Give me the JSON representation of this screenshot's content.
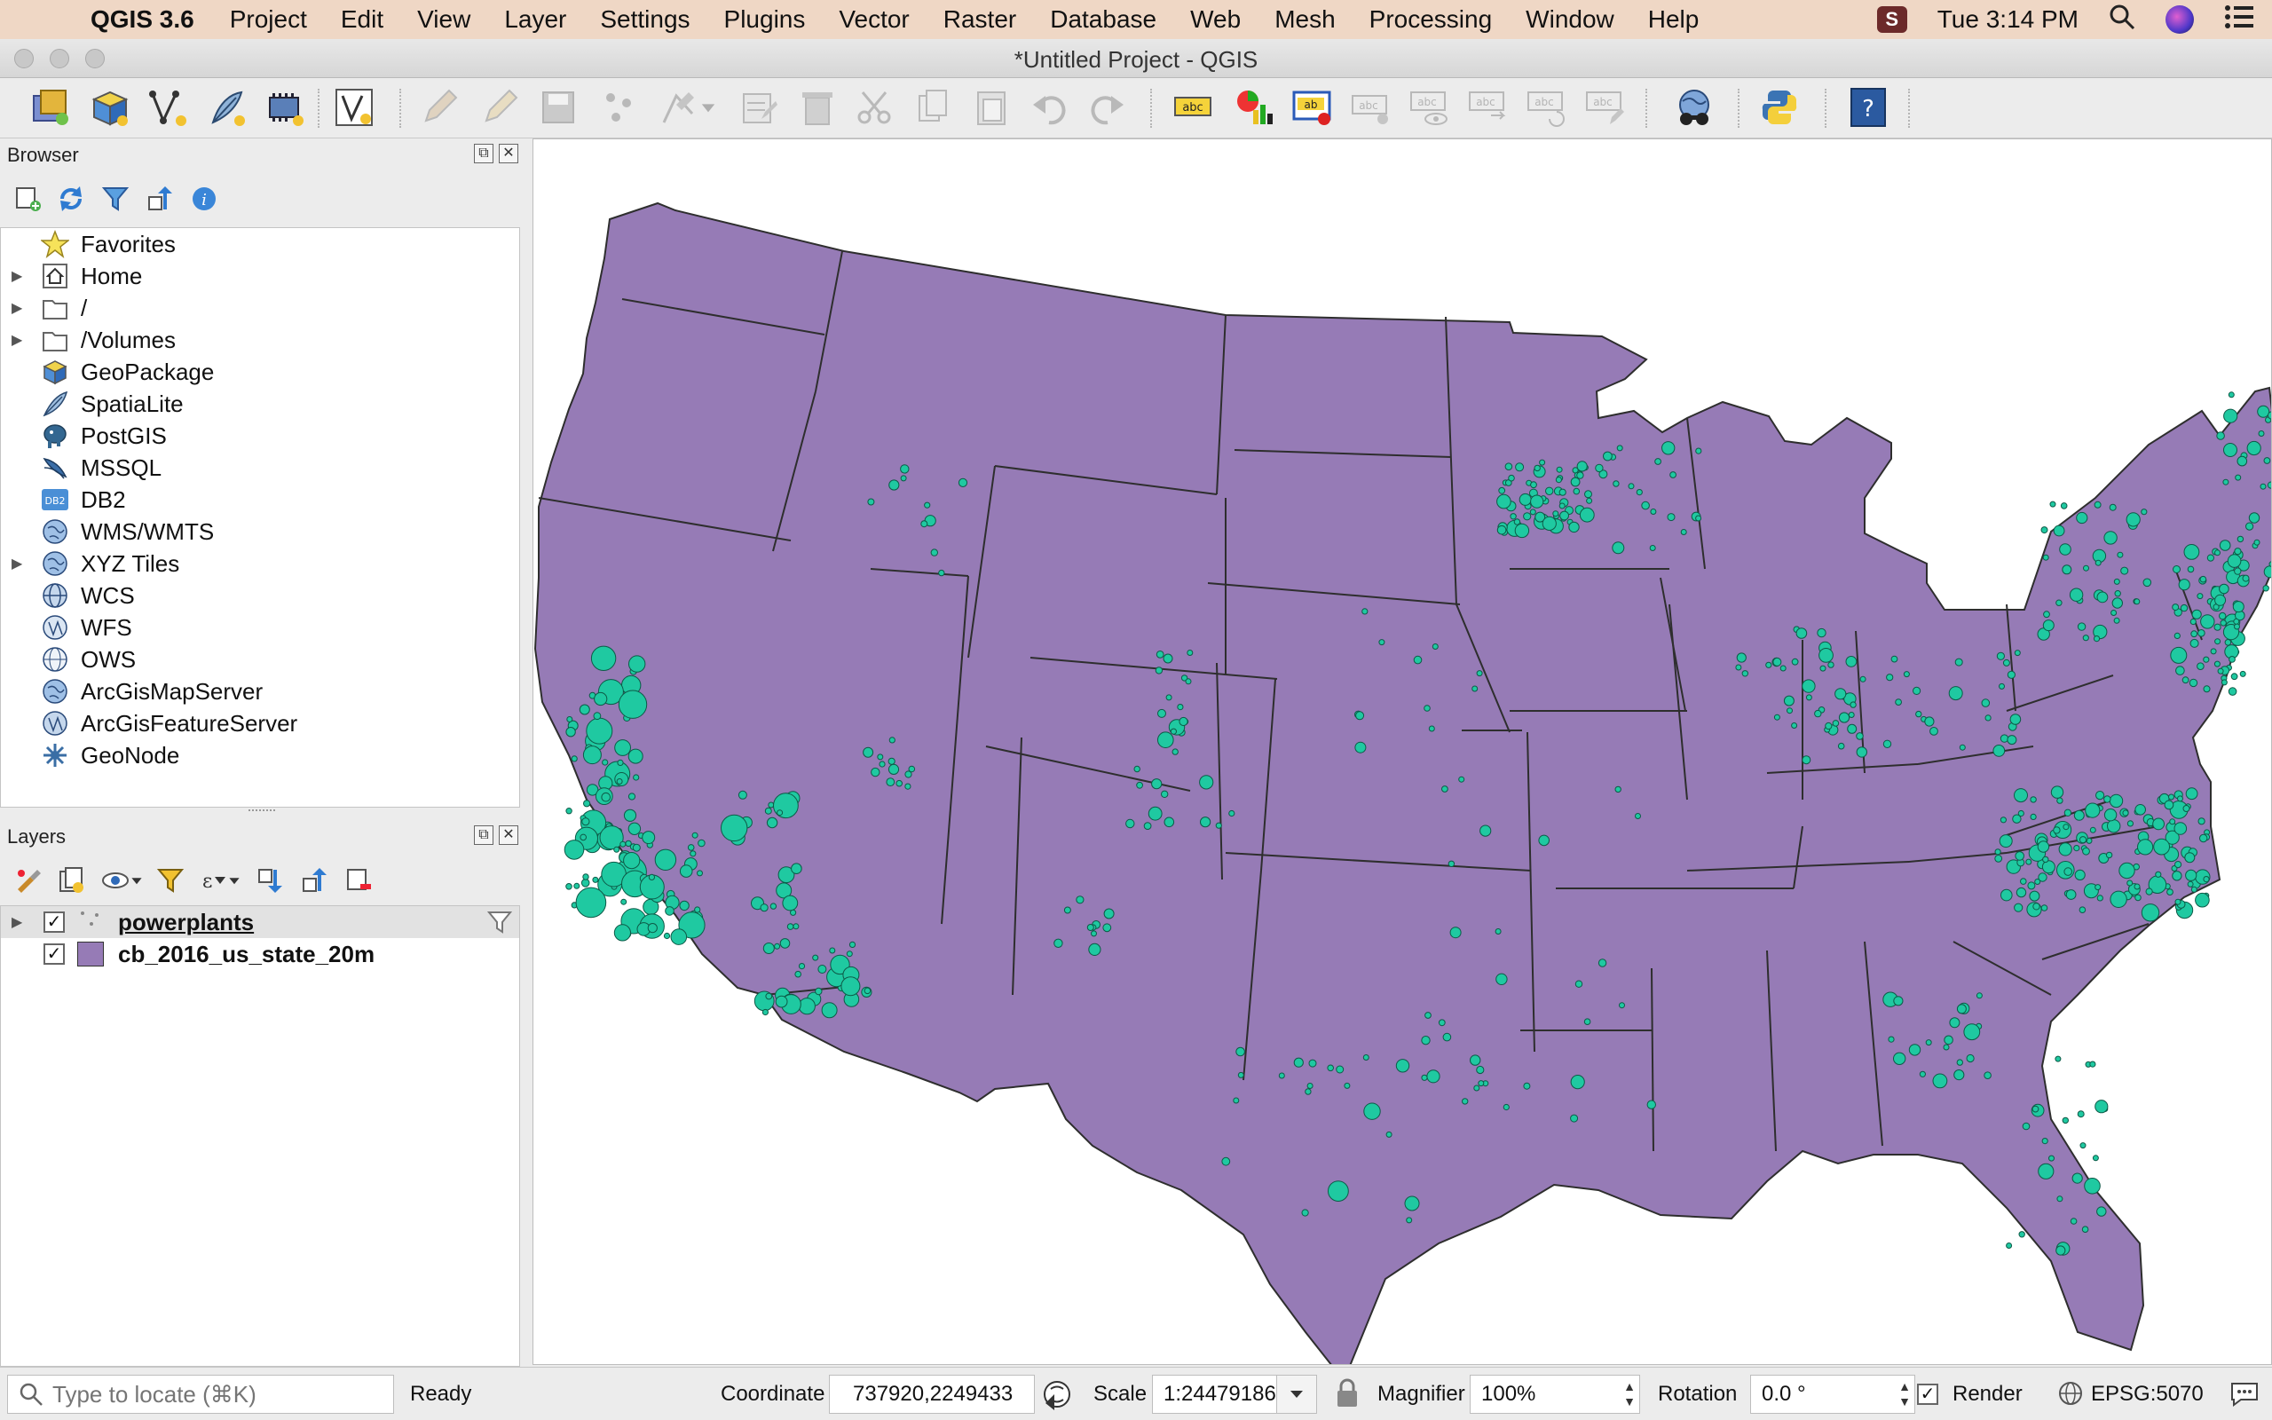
{
  "menubar": {
    "app_name": "QGIS 3.6",
    "items": [
      "Project",
      "Edit",
      "View",
      "Layer",
      "Settings",
      "Plugins",
      "Vector",
      "Raster",
      "Database",
      "Web",
      "Mesh",
      "Processing",
      "Window",
      "Help"
    ],
    "clock": "Tue 3:14 PM"
  },
  "window": {
    "title": "*Untitled Project - QGIS"
  },
  "browser": {
    "title": "Browser",
    "items": [
      {
        "label": "Favorites",
        "icon": "star-icon",
        "expandable": false
      },
      {
        "label": "Home",
        "icon": "home-icon",
        "expandable": true
      },
      {
        "label": "/",
        "icon": "folder-icon",
        "expandable": true
      },
      {
        "label": "/Volumes",
        "icon": "folder-icon",
        "expandable": true
      },
      {
        "label": "GeoPackage",
        "icon": "geopackage-icon",
        "expandable": false
      },
      {
        "label": "SpatiaLite",
        "icon": "feather-icon",
        "expandable": false
      },
      {
        "label": "PostGIS",
        "icon": "elephant-icon",
        "expandable": false
      },
      {
        "label": "MSSQL",
        "icon": "mssql-icon",
        "expandable": false
      },
      {
        "label": "DB2",
        "icon": "db2-icon",
        "expandable": false
      },
      {
        "label": "WMS/WMTS",
        "icon": "globe-icon",
        "expandable": false
      },
      {
        "label": "XYZ Tiles",
        "icon": "globe-icon",
        "expandable": true
      },
      {
        "label": "WCS",
        "icon": "globe-icon",
        "expandable": false
      },
      {
        "label": "WFS",
        "icon": "globe-icon",
        "expandable": false
      },
      {
        "label": "OWS",
        "icon": "globe-icon",
        "expandable": false
      },
      {
        "label": "ArcGisMapServer",
        "icon": "globe-icon",
        "expandable": false
      },
      {
        "label": "ArcGisFeatureServer",
        "icon": "globe-icon",
        "expandable": false
      },
      {
        "label": "GeoNode",
        "icon": "geonode-icon",
        "expandable": false
      }
    ]
  },
  "layers": {
    "title": "Layers",
    "items": [
      {
        "name": "powerplants",
        "checked": true,
        "type": "point",
        "selected": true
      },
      {
        "name": "cb_2016_us_state_20m",
        "checked": true,
        "type": "polygon",
        "fill": "#967bb6"
      }
    ]
  },
  "map": {
    "state_fill": "#967bb6",
    "state_stroke": "#2e2e2e",
    "point_fill": "#1fc9a1",
    "point_stroke": "#0d5a47"
  },
  "statusbar": {
    "locate_placeholder": "Type to locate (⌘K)",
    "status": "Ready",
    "coordinate_label": "Coordinate",
    "coordinate_value": "737920,2249433",
    "scale_label": "Scale",
    "scale_value": "1:24479186",
    "magnifier_label": "Magnifier",
    "magnifier_value": "100%",
    "rotation_label": "Rotation",
    "rotation_value": "0.0 °",
    "render_label": "Render",
    "render_checked": true,
    "crs": "EPSG:5070"
  }
}
